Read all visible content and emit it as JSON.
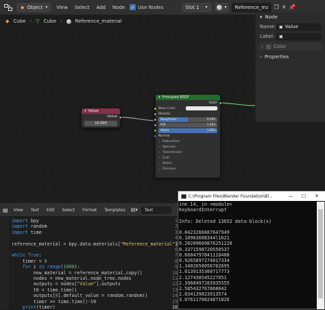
{
  "header": {
    "editor_type_icon": "node-editor-icon",
    "mode_label": "Object",
    "menus": [
      "View",
      "Select",
      "Add",
      "Node"
    ],
    "use_nodes_label": "Use Nodes",
    "use_nodes_checked": true,
    "slot_label": "Slot 1",
    "material_name": "Reference_material"
  },
  "breadcrumb": {
    "items": [
      "Cube",
      "Cube",
      "Reference_material"
    ]
  },
  "sidebar": {
    "section_node": "Node",
    "name_label": "Name:",
    "name_value": "Value",
    "label_label": "Label:",
    "label_value": "",
    "color_label": "Color",
    "properties_label": "Properties"
  },
  "value_node": {
    "title": "Value",
    "output_label": "Value",
    "value": "10.000",
    "header_color": "#83314a"
  },
  "bsdf_node": {
    "title": "Principled BSDF",
    "output_label": "BSDF",
    "header_color": "#236a2c",
    "base_color_label": "Base Color",
    "metallic_label": "Metallic",
    "roughness_label": "Roughness",
    "roughness_value": "0.500",
    "roughness_fraction": 0.5,
    "ior_label": "IOR",
    "ior_value": "1.450",
    "alpha_label": "Alpha",
    "alpha_value": "1.000",
    "alpha_fraction": 1.0,
    "normal_label": "Normal",
    "panels": [
      "Subsurface",
      "Specular",
      "Transmission",
      "Coat",
      "Sheen",
      "Emission"
    ]
  },
  "text_editor": {
    "menus": [
      "View",
      "Text",
      "Edit",
      "Select",
      "Format",
      "Templates"
    ],
    "file_name": "Text",
    "line_numbers": [
      "1",
      "2",
      "3",
      "4",
      "5",
      "6",
      "7",
      "8",
      "9",
      "10",
      "11",
      "12",
      "13",
      "14",
      "15",
      "16"
    ],
    "lines": [
      "import bpy",
      "import random",
      "import time",
      "",
      "reference_material = bpy.data.materials[\"Reference_material\"]",
      "",
      "while True:",
      "    timer = 0",
      "    for i in range(1000):",
      "        new_material = reference_material.copy()",
      "        nodes = new_material.node_tree.nodes",
      "        outputs = nodes[\"Value\"].outputs",
      "        t0 = time.time()",
      "        outputs[0].default_value = random.random()",
      "        timer += time.time()-t0",
      "    print(timer)"
    ]
  },
  "console": {
    "title": "C:\\Program Files\\Blender Foundation\\Bl...",
    "lines": [
      "ine 14, in <module>",
      "KeyboardInterrupt",
      "",
      "Info: Deleted 13652 data-block(s)",
      "",
      "0.0423266887647949",
      "0.10963608344l1621",
      "0.20209609876251220",
      "0.3371598720550537",
      "0.6604797841118408",
      "0.9265897274017334",
      "1.3402650056762695",
      "1.6139135360717773",
      "2.127438545227051",
      "2.3960497283935555",
      "2.585432767868042",
      "2.834139823913574",
      "3.0761170024871826"
    ]
  },
  "colors": {
    "accent": "#4772b3",
    "value_socket": "#a1a1a1",
    "shader_socket": "#63c763",
    "color_socket": "#c7c729",
    "vector_socket": "#6363c7"
  }
}
